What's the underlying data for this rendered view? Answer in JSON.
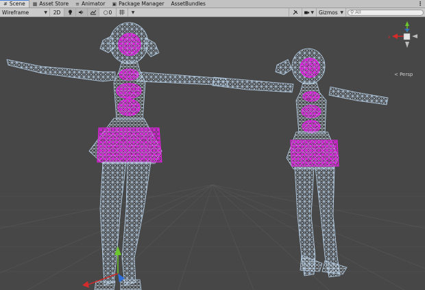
{
  "tabs": [
    {
      "label": "Scene",
      "icon": "scene-icon",
      "active": true
    },
    {
      "label": "Asset Store",
      "icon": "store-icon",
      "active": false
    },
    {
      "label": "Animator",
      "icon": "animator-icon",
      "active": false
    },
    {
      "label": "Package Manager",
      "icon": "package-icon",
      "active": false
    },
    {
      "label": "AssetBundles",
      "icon": "",
      "active": false
    }
  ],
  "toolbar": {
    "draw_mode": "Wireframe",
    "mode_2d": "2D",
    "light_icon": "lightbulb-icon",
    "audio_icon": "speaker-icon",
    "effects_icon": "effects-icon",
    "hidden_count": "0",
    "tools_icon": "tools-icon",
    "camera_icon": "camera-icon",
    "gizmos_label": "Gizmos",
    "search_placeholder": "All"
  },
  "gizmo": {
    "persp_label": "< Persp",
    "axis_x_label": "x",
    "colors": {
      "x": "#d62b2b",
      "y": "#6cc72c",
      "z": "#2f6fd9",
      "neutral": "#e4e4e4"
    }
  },
  "colors": {
    "viewport_bg": "#474747",
    "wire": "#b9d2ea",
    "mesh_highlight": "#e020e0",
    "grid": "#5a5a5a"
  }
}
